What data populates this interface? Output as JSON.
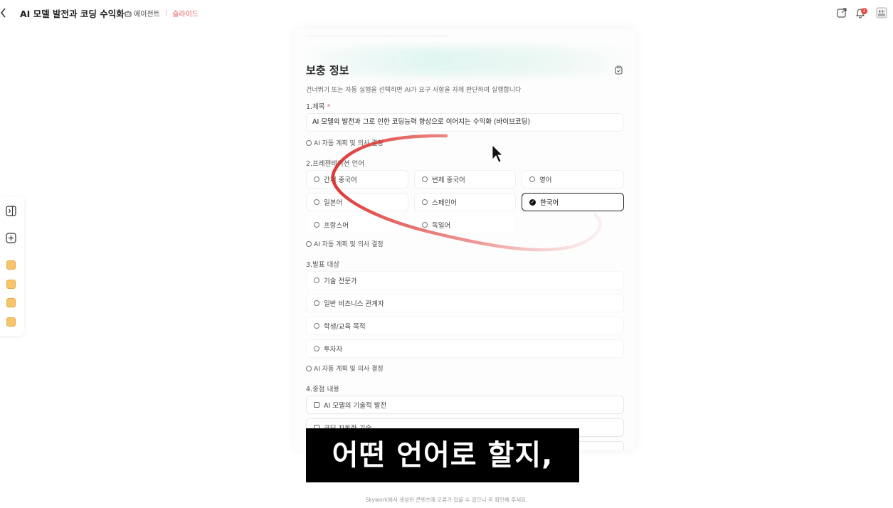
{
  "header": {
    "title": "AI 모델 발전과 코딩 수익화",
    "agent_label": "에이전트",
    "mode_label": "슬라이드",
    "notification_count": "2"
  },
  "form": {
    "section_title": "보충 정보",
    "section_desc": "건너뛰기 또는 자동 실행을 선택하면 AI가 요구 사항을 자체 판단하여 실행합니다",
    "auto_label": "AI 자동 계획 및 의사 결정",
    "q1": {
      "label": "1.제목",
      "required_mark": "*",
      "value": "AI 모델의 발전과 그로 인한 코딩능력 향상으로 이어지는 수익화 (바이브코딩)"
    },
    "q2": {
      "label": "2.프레젠테이션 언어",
      "options": [
        "간체 중국어",
        "번체 중국어",
        "영어",
        "일본어",
        "스페인어",
        "한국어",
        "프랑스어",
        "독일어"
      ],
      "selected": "한국어"
    },
    "q3": {
      "label": "3.발표 대상",
      "options": [
        "기술 전문가",
        "일반 비즈니스 관계자",
        "학생/교육 목적",
        "투자자"
      ]
    },
    "q4": {
      "label": "4.중점 내용",
      "options": [
        "AI 모델의 기술적 발전",
        "코딩 자동화 기술"
      ]
    }
  },
  "subtitle": "어떤 언어로 할지,",
  "footer": "Skywork에서 생성된 콘텐츠에 오류가 있을 수 있으니 꼭 확인해 주세요.",
  "colors": {
    "accent_red": "#e05a5a",
    "stroke_red": "#d9231f",
    "selected_border": "#222222"
  }
}
